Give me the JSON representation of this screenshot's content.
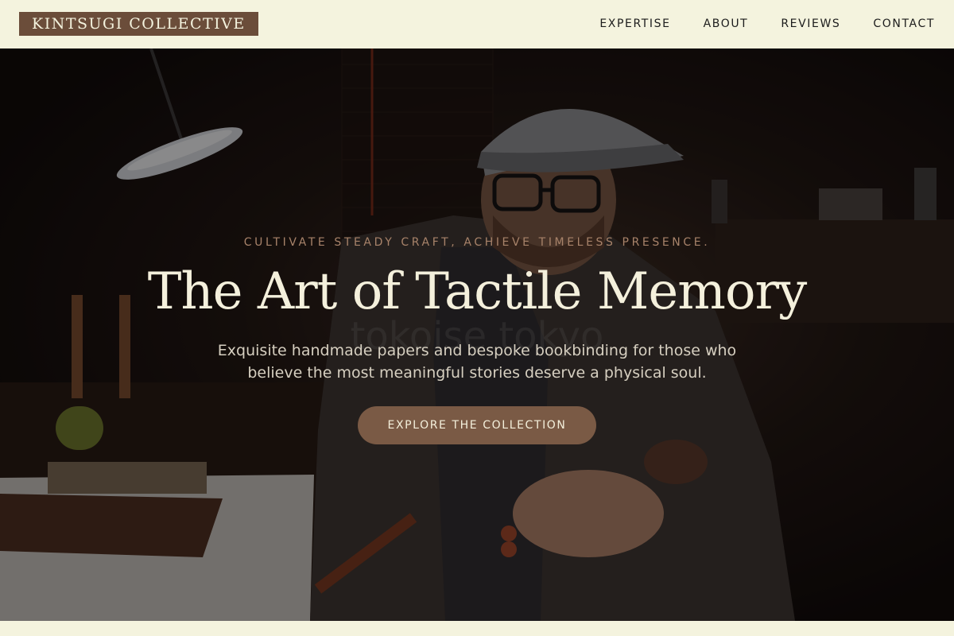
{
  "header": {
    "brand": "KINTSUGI COLLECTIVE",
    "nav": [
      "EXPERTISE",
      "ABOUT",
      "REVIEWS",
      "CONTACT"
    ]
  },
  "hero": {
    "eyebrow": "CULTIVATE STEADY CRAFT, ACHIEVE TIMELESS PRESENCE.",
    "headline": "The Art of Tactile Memory",
    "subtext": "Exquisite handmade papers and bespoke bookbinding for those who believe the most meaningful stories deserve a physical soul.",
    "cta_label": "EXPLORE THE COLLECTION",
    "watermark": "tokoise tokyo",
    "image_description": "artisan-wearing-cap-working-at-bench"
  },
  "colors": {
    "background": "#f4f3de",
    "brand_bg": "#6b4d3a",
    "cta_bg": "#7a5a45",
    "eyebrow": "#a8836a",
    "headline": "#f4f0dc"
  }
}
